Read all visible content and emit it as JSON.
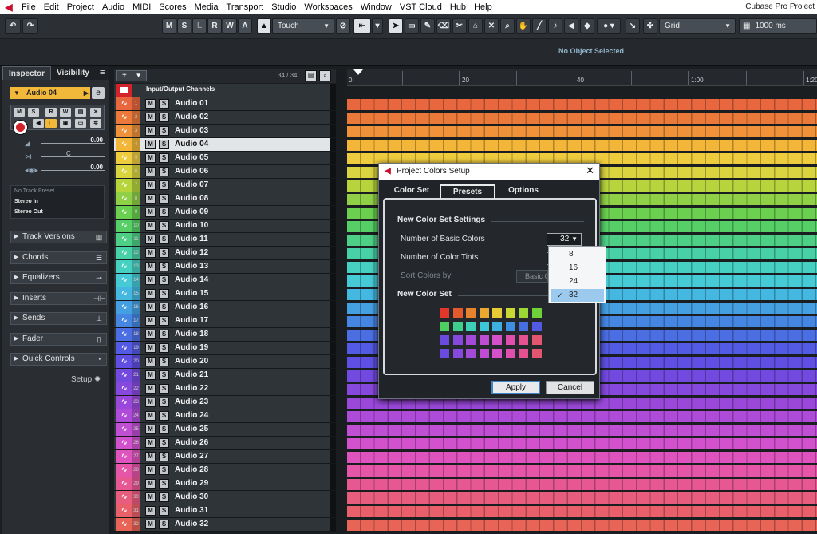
{
  "menubar": {
    "items": [
      "File",
      "Edit",
      "Project",
      "Audio",
      "MIDI",
      "Scores",
      "Media",
      "Transport",
      "Studio",
      "Workspaces",
      "Window",
      "VST Cloud",
      "Hub",
      "Help"
    ],
    "app_title": "Cubase Pro Project"
  },
  "toolbar": {
    "m": "M",
    "s": "S",
    "l": "L",
    "r": "R",
    "w": "W",
    "a": "A",
    "automation_mode": "Touch",
    "snap_type": "Grid",
    "grid_value": "1000 ms"
  },
  "status": {
    "no_object": "No Object Selected"
  },
  "inspector": {
    "tabs": [
      "Inspector",
      "Visibility"
    ],
    "track_name": "Audio 04",
    "fader_values": [
      "0.00",
      "C",
      "0.00"
    ],
    "preset": "No Track Preset",
    "stereo_in": "Stereo In",
    "stereo_out": "Stereo Out",
    "sections": [
      "Track Versions",
      "Chords",
      "Equalizers",
      "Inserts",
      "Sends",
      "Fader",
      "Quick Controls"
    ],
    "setup": "Setup"
  },
  "tracklist": {
    "count": "34 / 34",
    "io_label": "Input/Output Channels",
    "mute": "M",
    "solo": "S",
    "selected_index": 3,
    "tracks": [
      "Audio 01",
      "Audio 02",
      "Audio 03",
      "Audio 04",
      "Audio 05",
      "Audio 06",
      "Audio 07",
      "Audio 08",
      "Audio 09",
      "Audio 10",
      "Audio 11",
      "Audio 12",
      "Audio 13",
      "Audio 14",
      "Audio 15",
      "Audio 16",
      "Audio 17",
      "Audio 18",
      "Audio 19",
      "Audio 20",
      "Audio 21",
      "Audio 22",
      "Audio 23",
      "Audio 24",
      "Audio 25",
      "Audio 26",
      "Audio 27",
      "Audio 28",
      "Audio 29",
      "Audio 30",
      "Audio 31",
      "Audio 32"
    ],
    "colors": [
      "#e8673f",
      "#eb7a3a",
      "#ef9239",
      "#f3b638",
      "#efcc3e",
      "#d9d43f",
      "#b8d43d",
      "#8fd046",
      "#6bd04f",
      "#56cf66",
      "#4ecf86",
      "#48d0a6",
      "#46d0c2",
      "#45cad6",
      "#44b8e0",
      "#45a0e2",
      "#4686e3",
      "#4c6ee3",
      "#535ae3",
      "#5f4fe2",
      "#734ae0",
      "#8748dd",
      "#9a48da",
      "#ae4bd8",
      "#c14fd4",
      "#d252ce",
      "#de53bd",
      "#e555a8",
      "#e75893",
      "#e85c7e",
      "#e9606b",
      "#e86456"
    ]
  },
  "ruler": {
    "labels": [
      "0",
      "20",
      "40",
      "1:00",
      "1:20"
    ]
  },
  "dialog": {
    "title": "Project Colors Setup",
    "tabs": [
      "Color Set",
      "Presets",
      "Options"
    ],
    "section1": "New Color Set Settings",
    "num_basic_label": "Number of Basic Colors",
    "num_basic_value": "32",
    "num_tints_label": "Number of Color Tints",
    "sort_label": "Sort Colors by",
    "sort_value": "Basic Colors",
    "section2": "New Color Set",
    "swatches": [
      "#e2372a",
      "#e45a2c",
      "#e7832f",
      "#eaa831",
      "#e7cc33",
      "#c9d934",
      "#9bd836",
      "#6fd23a",
      "#4dd060",
      "#3fcf8c",
      "#3dcfb8",
      "#3dc8d8",
      "#3db0e0",
      "#3e8fe2",
      "#4670e2",
      "#5259e2",
      "#6a4be0",
      "#8748dd",
      "#a34ad9",
      "#bf4dd4",
      "#d650c9",
      "#e04fae",
      "#e55191",
      "#e45570"
    ],
    "apply": "Apply",
    "cancel": "Cancel"
  },
  "dropdown": {
    "options": [
      "8",
      "16",
      "24",
      "32"
    ],
    "selected": "32"
  }
}
